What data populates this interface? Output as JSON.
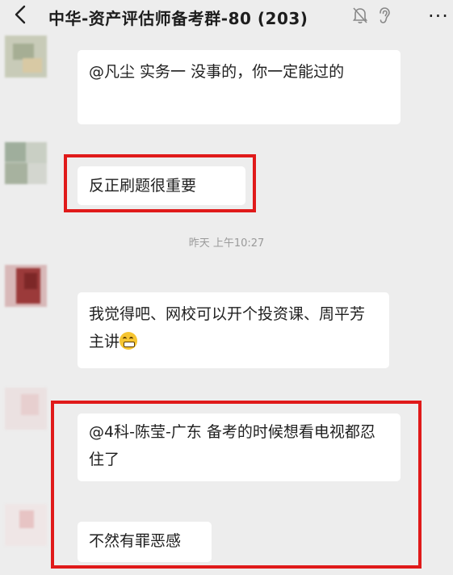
{
  "header": {
    "back_icon": "chevron-left-icon",
    "title": "中华-资产评估师备考群-80 (203)",
    "mute_icon": "bell-off-icon",
    "ear_icon": "ear-icon",
    "more_label": "···"
  },
  "messages": [
    {
      "text": "@凡尘  实务一  没事的，你一定能过的"
    },
    {
      "text": "反正刷题很重要"
    },
    {
      "timestamp": "昨天 上午10:27"
    },
    {
      "text": "我觉得吧、网校可以开个投资课、周平芳主讲"
    },
    {
      "text": "@4科-陈莹-广东  备考的时候想看电视都忍住了"
    },
    {
      "text": "不然有罪恶感"
    }
  ],
  "colors": {
    "background": "#ededed",
    "bubble": "#ffffff",
    "highlight_box": "#e01a1a"
  }
}
